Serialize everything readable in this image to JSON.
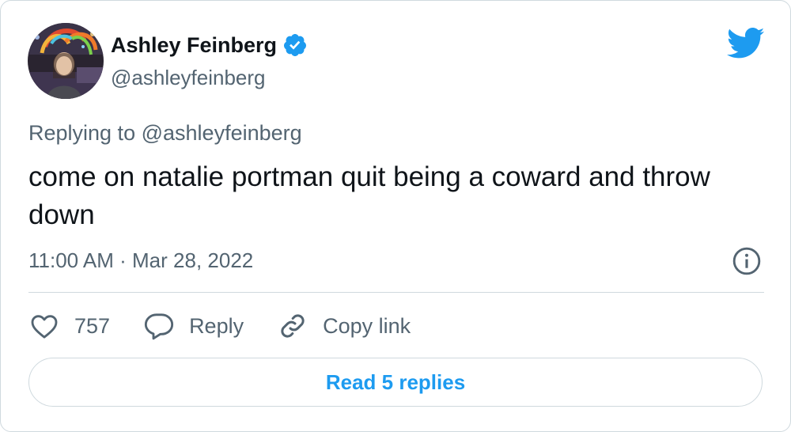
{
  "author": {
    "display_name": "Ashley Feinberg",
    "handle": "@ashleyfeinberg",
    "verified": true
  },
  "tweet": {
    "replying_prefix": "Replying to",
    "replying_to": "@ashleyfeinberg",
    "text": "come on natalie portman quit being a coward and throw down",
    "timestamp": "11:00 AM · Mar 28, 2022"
  },
  "actions": {
    "like_count": "757",
    "reply_label": "Reply",
    "copy_link_label": "Copy link"
  },
  "footer": {
    "read_replies_label": "Read 5 replies"
  },
  "icons": {
    "brand": "twitter-bird-icon",
    "verified": "verified-badge-icon",
    "info": "info-icon",
    "like": "heart-icon",
    "reply": "speech-bubble-icon",
    "copy_link": "link-icon"
  },
  "colors": {
    "accent": "#1d9bf0",
    "text_primary": "#0f1419",
    "text_secondary": "#536471",
    "border": "#cfd9de"
  }
}
